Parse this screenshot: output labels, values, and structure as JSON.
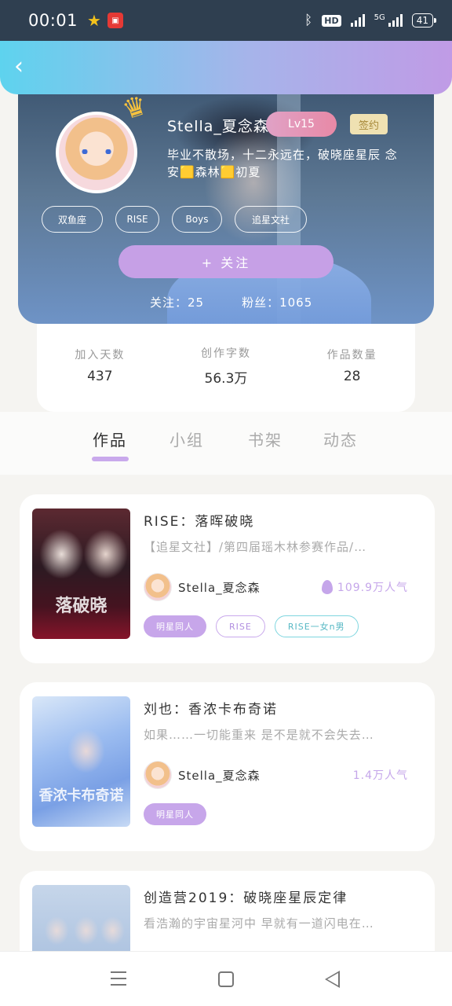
{
  "status_bar": {
    "time": "00:01",
    "hd": "HD",
    "net": "5G",
    "battery": "41"
  },
  "profile": {
    "username": "Stella_夏念森",
    "level": "Lv15",
    "signed_label": "签约",
    "bio": "毕业不散场，十二永远在，破晓座星辰 念安🟨森林🟨初夏",
    "tags": [
      "双鱼座",
      "RISE",
      "Boys",
      "追星文社"
    ],
    "follow_button": "+ 关注",
    "following": "关注：25",
    "followers": "粉丝：1065"
  },
  "stats": [
    {
      "label": "加入天数",
      "value": "437"
    },
    {
      "label": "创作字数",
      "value": "56.3万"
    },
    {
      "label": "作品数量",
      "value": "28"
    }
  ],
  "tabs": [
    "作品",
    "小组",
    "书架",
    "动态"
  ],
  "active_tab": "作品",
  "works": [
    {
      "title": "RISE：落晖破晓",
      "description": "【追星文社】/第四届瑶木林参赛作品/…",
      "author": "Stella_夏念森",
      "popularity": "109.9万人气",
      "cover_text": "落破晓",
      "chips": [
        "明星同人",
        "RISE",
        "RISE一女n男"
      ]
    },
    {
      "title": "刘也：香浓卡布奇诺",
      "description": "如果……一切能重来 是不是就不会失去…",
      "author": "Stella_夏念森",
      "popularity": "1.4万人气",
      "cover_text": "香浓卡布奇诺",
      "chips": [
        "明星同人"
      ]
    },
    {
      "title": "创造营2019：破晓座星辰定律",
      "description": "看浩瀚的宇宙星河中 早就有一道闪电在…",
      "author": "",
      "popularity": "",
      "cover_text": "",
      "chips": []
    }
  ],
  "colors": {
    "accent": "#c6a0e6",
    "header_start": "#5ed3ee",
    "header_end": "#c09be6",
    "chip_cyan": "#7fd6df"
  }
}
